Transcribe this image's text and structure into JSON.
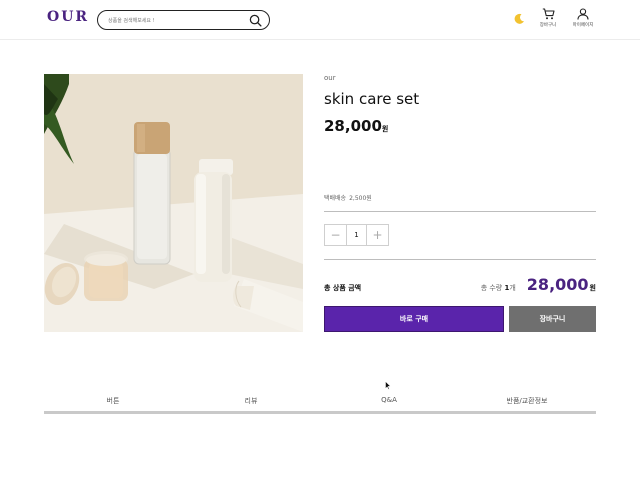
{
  "header": {
    "logo": "OUR",
    "search_placeholder": "상품을 검색해보세요 !",
    "cart_label": "장바구니",
    "mypage_label": "마이페이지"
  },
  "product": {
    "brand": "our",
    "name": "skin care set",
    "price": "28,000",
    "price_unit": "원",
    "shipping_label": "택배배송",
    "shipping_fee": "2,500원",
    "quantity": "1",
    "qty_minus": "−",
    "qty_plus": "+"
  },
  "summary": {
    "total_label": "총 상품 금액",
    "count_prefix": "총 수량",
    "count_value": "1",
    "count_unit": "개",
    "total_price": "28,000",
    "total_unit": "원"
  },
  "actions": {
    "buy_label": "바로 구매",
    "cart_label": "장바구니"
  },
  "tabs": [
    {
      "label": "버튼"
    },
    {
      "label": "리뷰"
    },
    {
      "label": "Q&A"
    },
    {
      "label": "반품/교환정보"
    }
  ],
  "colors": {
    "brand": "#4a2380",
    "buy_button": "#5a24ab",
    "cart_button": "#6f6f6f",
    "moon": "#f2c230"
  },
  "icons": [
    "search-icon",
    "moon-icon",
    "cart-icon",
    "user-icon",
    "minus-icon",
    "plus-icon",
    "cursor-icon"
  ]
}
